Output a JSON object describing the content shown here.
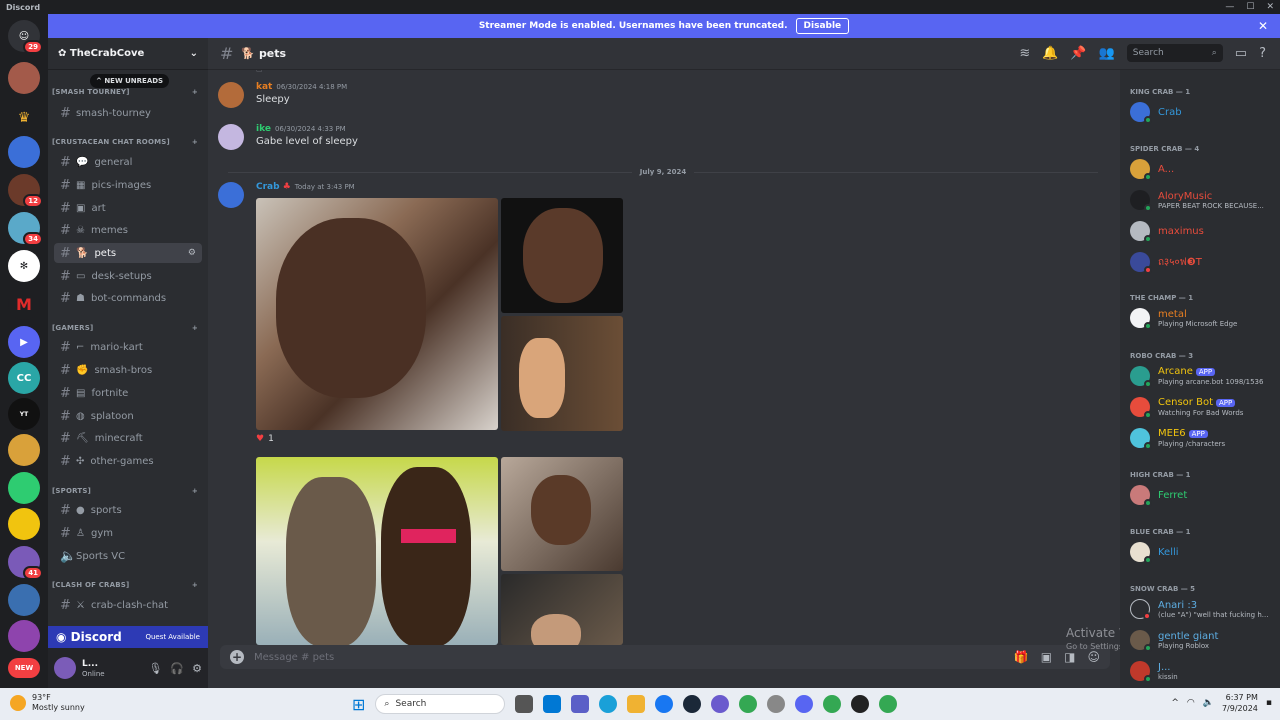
{
  "window": {
    "title": "Discord"
  },
  "banner": {
    "text": "Streamer Mode is enabled. Usernames have been truncated.",
    "button": "Disable"
  },
  "rail": {
    "badges": [
      "29",
      "12",
      "34",
      "41"
    ],
    "new_label": "NEW"
  },
  "guild": {
    "name": "TheCrabCove",
    "new_unreads": "NEW UNREADS"
  },
  "categories": {
    "smash": "[SMASH TOURNEY]",
    "crustacean": "[CRUSTACEAN CHAT ROOMS]",
    "gamers": "[GAMERS]",
    "sports": "[SPORTS]",
    "clash": "[CLASH OF CRABS]"
  },
  "channels": {
    "smash_tourney": "smash-tourney",
    "general": "general",
    "pics": "pics-images",
    "art": "art",
    "memes": "memes",
    "pets": "pets",
    "desk": "desk-setups",
    "bot": "bot-commands",
    "mario": "mario-kart",
    "smashbros": "smash-bros",
    "fortnite": "fortnite",
    "splatoon": "splatoon",
    "minecraft": "minecraft",
    "other": "other-games",
    "sports": "sports",
    "gym": "gym",
    "sportsvc": "Sports VC",
    "crabclash": "crab-clash-chat"
  },
  "promo": {
    "brand": "Discord",
    "quest": "Quest Available"
  },
  "user": {
    "name": "L...",
    "status": "Online"
  },
  "header": {
    "channel": "pets",
    "search_placeholder": "Search"
  },
  "messages": [
    {
      "author": "kat",
      "time": "06/30/2024 4:18 PM",
      "text": "Sleepy",
      "color": "#e67e22"
    },
    {
      "author": "ike",
      "time": "06/30/2024 4:33 PM",
      "text": "Gabe level of sleepy",
      "color": "#2ecc71"
    },
    {
      "author": "Crab",
      "time": "Today at 3:43 PM",
      "text": "",
      "color": "#3498db"
    }
  ],
  "date_divider": "July 9, 2024",
  "reaction_count": "1",
  "composer": {
    "placeholder": "Message # pets"
  },
  "watermark": {
    "title": "Activate Windows",
    "sub": "Go to Settings to activate Windows."
  },
  "members": {
    "king": {
      "label": "KING CRAB — 1",
      "m1": "Crab"
    },
    "spider": {
      "label": "SPIDER CRAB — 4",
      "m1": "A...",
      "m2": "AloryMusic",
      "m2s": "PAPER BEAT ROCK BECAUSE...",
      "m3": "maximus",
      "m4": "ถ३५०ฟ❸Τ"
    },
    "champ": {
      "label": "THE CHAMP — 1",
      "m1": "metal",
      "m1s": "Playing Microsoft Edge"
    },
    "robo": {
      "label": "ROBO CRAB — 3",
      "m1": "Arcane",
      "m1s": "Playing arcane.bot 1098/1536",
      "m2": "Censor Bot",
      "m2s": "Watching For Bad Words",
      "m3": "MEE6",
      "m3s": "Playing /characters",
      "app": "APP"
    },
    "high": {
      "label": "HIGH CRAB — 1",
      "m1": "Ferret"
    },
    "blue": {
      "label": "BLUE CRAB — 1",
      "m1": "Kelli"
    },
    "snow": {
      "label": "SNOW CRAB — 5",
      "m1": "Anari :3",
      "m1s": "(clue \"A\") \"well that fucking h...",
      "m2": "gentle giant",
      "m2s": "Playing Roblox",
      "m3": "J...",
      "m3s": "kissin"
    }
  },
  "taskbar": {
    "temp": "93°F",
    "weather": "Mostly sunny",
    "search": "Search",
    "time": "6:37 PM",
    "date": "7/9/2024"
  }
}
